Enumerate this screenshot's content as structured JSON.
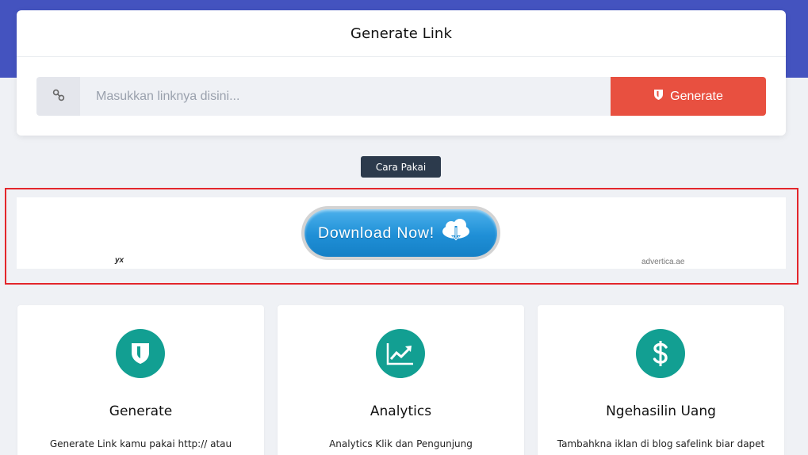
{
  "generator": {
    "title": "Generate Link",
    "input_placeholder": "Masukkan linknya disini...",
    "input_value": "",
    "generate_label": "Generate"
  },
  "howto_label": "Cara Pakai",
  "ad": {
    "button_label": "Download Now!",
    "mark": "yx",
    "source": "advertica.ae"
  },
  "features": [
    {
      "icon": "shield-icon",
      "title": "Generate",
      "description": "Generate Link kamu pakai http:// atau"
    },
    {
      "icon": "analytics-chart-icon",
      "title": "Analytics",
      "description": "Analytics Klik dan Pengunjung"
    },
    {
      "icon": "dollar-icon",
      "title": "Ngehasilin Uang",
      "description": "Tambahkna iklan di blog safelink biar dapet"
    }
  ],
  "colors": {
    "header_band": "#4453bf",
    "generate_button": "#e85040",
    "howto_button": "#2c3a4c",
    "feature_icon_bg": "#129f92",
    "ad_outline": "#e3262b"
  }
}
